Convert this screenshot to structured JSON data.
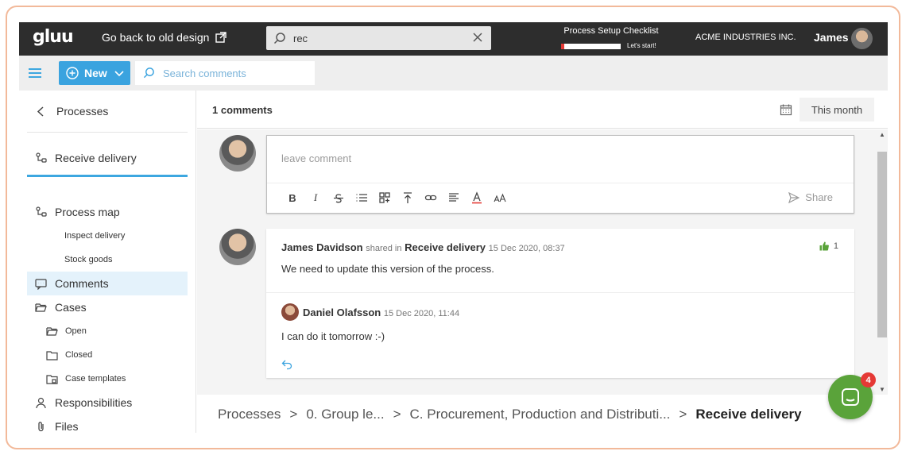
{
  "topbar": {
    "logo": "gluu",
    "old_design_link": "Go back to old design",
    "search_value": "rec",
    "checklist_title": "Process Setup Checklist",
    "checklist_progress": 0.05,
    "checklist_cta": "Let's start!",
    "company": "ACME INDUSTRIES INC.",
    "user_name": "James"
  },
  "subbar": {
    "new_label": "New",
    "search_placeholder": "Search comments"
  },
  "sidebar": {
    "back_label": "Processes",
    "items": [
      {
        "label": "Receive delivery"
      },
      {
        "label": "Process map"
      },
      {
        "label": "Inspect delivery"
      },
      {
        "label": "Stock goods"
      },
      {
        "label": "Comments"
      },
      {
        "label": "Cases"
      },
      {
        "label": "Open"
      },
      {
        "label": "Closed"
      },
      {
        "label": "Case templates"
      },
      {
        "label": "Responsibilities"
      },
      {
        "label": "Files"
      }
    ]
  },
  "main": {
    "count_label": "1 comments",
    "period_label": "This month",
    "compose_placeholder": "leave comment",
    "share_label": "Share",
    "toolbar": [
      "B",
      "I"
    ],
    "comment": {
      "author": "James Davidson",
      "shared_in": "shared in",
      "location": "Receive delivery",
      "timestamp": "15 Dec 2020, 08:37",
      "text": "We need to update this version of the process.",
      "likes": "1"
    },
    "reply": {
      "author": "Daniel Olafsson",
      "timestamp": "15 Dec 2020, 11:44",
      "text": "I can do it tomorrow :-)"
    }
  },
  "breadcrumb": {
    "items": [
      "Processes",
      "0. Group le...",
      "C. Procurement, Production and Distributi...",
      "Receive delivery"
    ],
    "separator": ">"
  },
  "chat": {
    "badge": "4"
  },
  "colors": {
    "accent": "#3aa3df",
    "topbar": "#2d2d2d",
    "chat": "#5aa33a",
    "badge": "#e53935"
  }
}
